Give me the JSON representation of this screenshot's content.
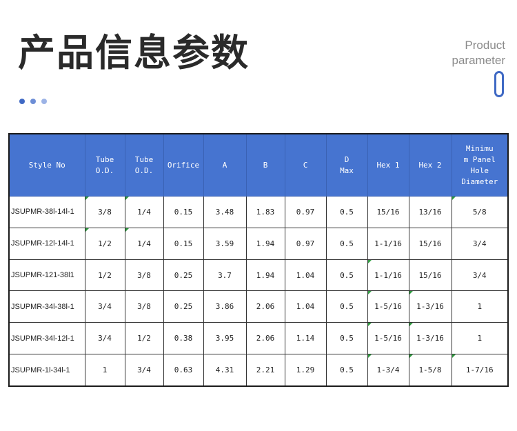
{
  "title_cn": "产品信息参数",
  "title_en_line1": "Product",
  "title_en_line2": "parameter",
  "accent_color": "#4674d0",
  "headers": [
    "Style No",
    "Tube\nO.D.",
    "Tube\nO.D.",
    "Orifice",
    "A",
    "B",
    "C",
    "D\nMax",
    "Hex 1",
    "Hex 2",
    "Minimu\nm Panel\nHole\nDiameter"
  ],
  "rows": [
    [
      "JSUPMR-38l-14l-1",
      "3/8",
      "1/4",
      "0.15",
      "3.48",
      "1.83",
      "0.97",
      "0.5",
      "15/16",
      "13/16",
      "5/8"
    ],
    [
      "JSUPMR-12l-14l-1",
      "1/2",
      "1/4",
      "0.15",
      "3.59",
      "1.94",
      "0.97",
      "0.5",
      "1-1/16",
      "15/16",
      "3/4"
    ],
    [
      "JSUPMR-121-38l1",
      "1/2",
      "3/8",
      "0.25",
      "3.7",
      "1.94",
      "1.04",
      "0.5",
      "1-1/16",
      "15/16",
      "3/4"
    ],
    [
      "JSUPMR-34l-38l-1",
      "3/4",
      "3/8",
      "0.25",
      "3.86",
      "2.06",
      "1.04",
      "0.5",
      "1-5/16",
      "1-3/16",
      "1"
    ],
    [
      "JSUPMR-34l-12l-1",
      "3/4",
      "1/2",
      "0.38",
      "3.95",
      "2.06",
      "1.14",
      "0.5",
      "1-5/16",
      "1-3/16",
      "1"
    ],
    [
      "JSUPMR-1l-34l-1",
      "1",
      "3/4",
      "0.63",
      "4.31",
      "2.21",
      "1.29",
      "0.5",
      "1-3/4",
      "1-5/8",
      "1-7/16"
    ]
  ]
}
